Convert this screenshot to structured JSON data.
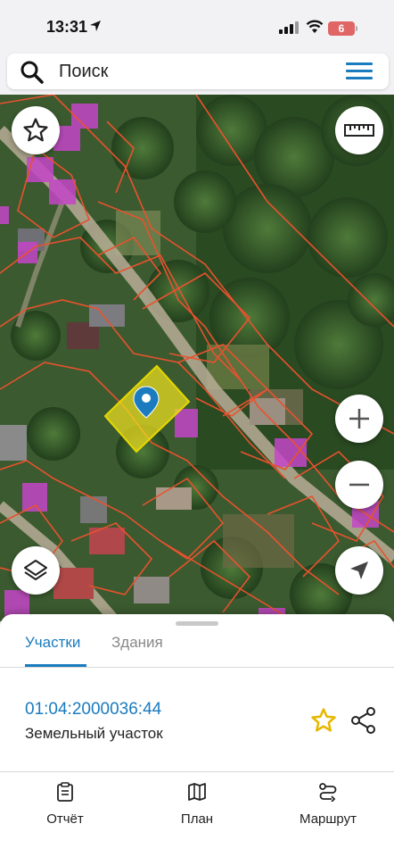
{
  "status_bar": {
    "time": "13:31",
    "battery": "6"
  },
  "search": {
    "placeholder": "Поиск"
  },
  "map": {
    "icons": [
      "star-outline-icon",
      "ruler-icon",
      "zoom-in-icon",
      "zoom-out-icon",
      "layers-icon",
      "location-arrow-icon",
      "map-pin-icon"
    ],
    "colors": {
      "parcel_border": "#e8522e",
      "selected_parcel": "#f0e020",
      "building": "#c545c8",
      "pin": "#1a7bbf"
    }
  },
  "sheet": {
    "tabs": [
      {
        "label": "Участки",
        "active": true
      },
      {
        "label": "Здания",
        "active": false
      }
    ],
    "result": {
      "cadastral_number": "01:04:2000036:44",
      "type": "Земельный участок"
    }
  },
  "bottom_nav": [
    {
      "label": "Отчёт",
      "icon": "report-icon"
    },
    {
      "label": "План",
      "icon": "map-plan-icon"
    },
    {
      "label": "Маршрут",
      "icon": "route-icon"
    }
  ],
  "colors": {
    "accent": "#1a7bbf",
    "star": "#e6b800"
  }
}
